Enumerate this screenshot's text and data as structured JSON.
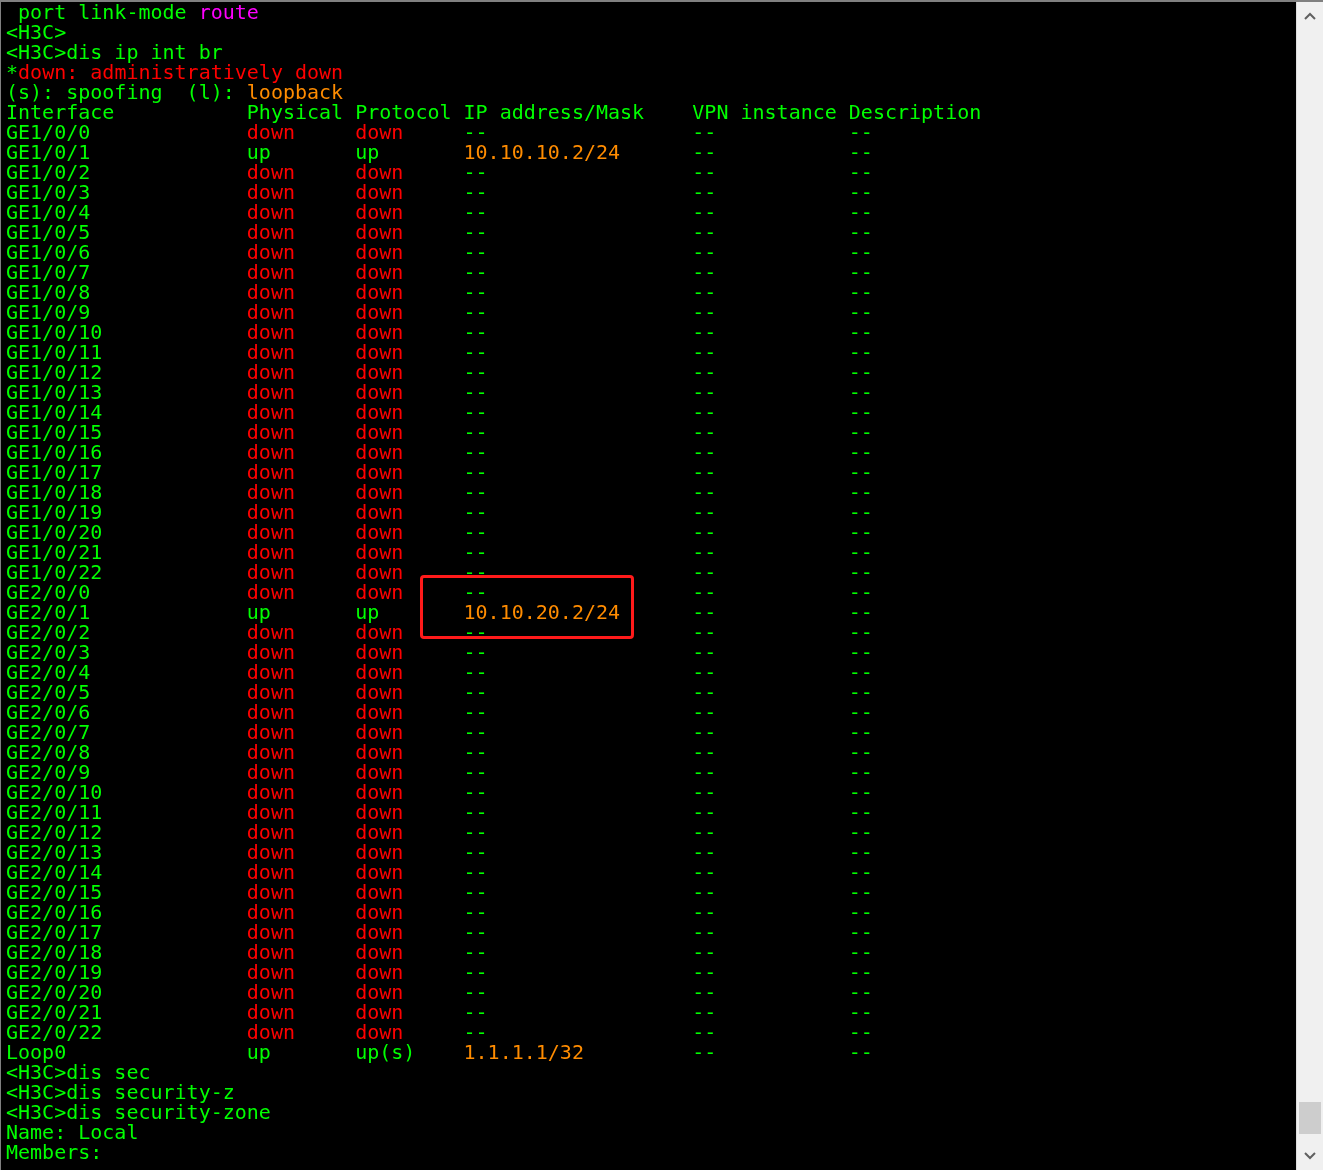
{
  "terminal": {
    "lines_before": [
      {
        "indent": true,
        "segments": [
          {
            "text": "port link-mode ",
            "color": "#00ff00"
          },
          {
            "text": "route",
            "color": "#ff00ff"
          }
        ]
      },
      {
        "indent": false,
        "segments": [
          {
            "text": "<H3C>",
            "color": "#00ff00"
          }
        ]
      },
      {
        "indent": false,
        "segments": [
          {
            "text": "<H3C>dis ip int br",
            "color": "#00ff00"
          }
        ]
      },
      {
        "indent": false,
        "segments": [
          {
            "text": "*",
            "color": "#00ff00"
          },
          {
            "text": "down: administratively down",
            "color": "#ff0000"
          }
        ]
      },
      {
        "indent": false,
        "segments": [
          {
            "text": "(s): spoofing  (l): ",
            "color": "#00ff00"
          },
          {
            "text": "loopback",
            "color": "#ff8c00"
          }
        ]
      }
    ],
    "table": {
      "columns": [
        "Interface",
        "Physical",
        "Protocol",
        "IP address/Mask",
        "VPN instance",
        "Description"
      ],
      "rows": [
        {
          "interface": "GE1/0/0",
          "physical": "down",
          "physical_up": false,
          "protocol": "down",
          "protocol_up": false,
          "ip": "--",
          "ip_assigned": false,
          "vpn": "--",
          "description": "--",
          "highlighted": false
        },
        {
          "interface": "GE1/0/1",
          "physical": "up",
          "physical_up": true,
          "protocol": "up",
          "protocol_up": true,
          "ip": "10.10.10.2/24",
          "ip_assigned": true,
          "vpn": "--",
          "description": "--",
          "highlighted": false
        },
        {
          "interface": "GE1/0/2",
          "physical": "down",
          "physical_up": false,
          "protocol": "down",
          "protocol_up": false,
          "ip": "--",
          "ip_assigned": false,
          "vpn": "--",
          "description": "--",
          "highlighted": false
        },
        {
          "interface": "GE1/0/3",
          "physical": "down",
          "physical_up": false,
          "protocol": "down",
          "protocol_up": false,
          "ip": "--",
          "ip_assigned": false,
          "vpn": "--",
          "description": "--",
          "highlighted": false
        },
        {
          "interface": "GE1/0/4",
          "physical": "down",
          "physical_up": false,
          "protocol": "down",
          "protocol_up": false,
          "ip": "--",
          "ip_assigned": false,
          "vpn": "--",
          "description": "--",
          "highlighted": false
        },
        {
          "interface": "GE1/0/5",
          "physical": "down",
          "physical_up": false,
          "protocol": "down",
          "protocol_up": false,
          "ip": "--",
          "ip_assigned": false,
          "vpn": "--",
          "description": "--",
          "highlighted": false
        },
        {
          "interface": "GE1/0/6",
          "physical": "down",
          "physical_up": false,
          "protocol": "down",
          "protocol_up": false,
          "ip": "--",
          "ip_assigned": false,
          "vpn": "--",
          "description": "--",
          "highlighted": false
        },
        {
          "interface": "GE1/0/7",
          "physical": "down",
          "physical_up": false,
          "protocol": "down",
          "protocol_up": false,
          "ip": "--",
          "ip_assigned": false,
          "vpn": "--",
          "description": "--",
          "highlighted": false
        },
        {
          "interface": "GE1/0/8",
          "physical": "down",
          "physical_up": false,
          "protocol": "down",
          "protocol_up": false,
          "ip": "--",
          "ip_assigned": false,
          "vpn": "--",
          "description": "--",
          "highlighted": false
        },
        {
          "interface": "GE1/0/9",
          "physical": "down",
          "physical_up": false,
          "protocol": "down",
          "protocol_up": false,
          "ip": "--",
          "ip_assigned": false,
          "vpn": "--",
          "description": "--",
          "highlighted": false
        },
        {
          "interface": "GE1/0/10",
          "physical": "down",
          "physical_up": false,
          "protocol": "down",
          "protocol_up": false,
          "ip": "--",
          "ip_assigned": false,
          "vpn": "--",
          "description": "--",
          "highlighted": false
        },
        {
          "interface": "GE1/0/11",
          "physical": "down",
          "physical_up": false,
          "protocol": "down",
          "protocol_up": false,
          "ip": "--",
          "ip_assigned": false,
          "vpn": "--",
          "description": "--",
          "highlighted": false
        },
        {
          "interface": "GE1/0/12",
          "physical": "down",
          "physical_up": false,
          "protocol": "down",
          "protocol_up": false,
          "ip": "--",
          "ip_assigned": false,
          "vpn": "--",
          "description": "--",
          "highlighted": false
        },
        {
          "interface": "GE1/0/13",
          "physical": "down",
          "physical_up": false,
          "protocol": "down",
          "protocol_up": false,
          "ip": "--",
          "ip_assigned": false,
          "vpn": "--",
          "description": "--",
          "highlighted": false
        },
        {
          "interface": "GE1/0/14",
          "physical": "down",
          "physical_up": false,
          "protocol": "down",
          "protocol_up": false,
          "ip": "--",
          "ip_assigned": false,
          "vpn": "--",
          "description": "--",
          "highlighted": false
        },
        {
          "interface": "GE1/0/15",
          "physical": "down",
          "physical_up": false,
          "protocol": "down",
          "protocol_up": false,
          "ip": "--",
          "ip_assigned": false,
          "vpn": "--",
          "description": "--",
          "highlighted": false
        },
        {
          "interface": "GE1/0/16",
          "physical": "down",
          "physical_up": false,
          "protocol": "down",
          "protocol_up": false,
          "ip": "--",
          "ip_assigned": false,
          "vpn": "--",
          "description": "--",
          "highlighted": false
        },
        {
          "interface": "GE1/0/17",
          "physical": "down",
          "physical_up": false,
          "protocol": "down",
          "protocol_up": false,
          "ip": "--",
          "ip_assigned": false,
          "vpn": "--",
          "description": "--",
          "highlighted": false
        },
        {
          "interface": "GE1/0/18",
          "physical": "down",
          "physical_up": false,
          "protocol": "down",
          "protocol_up": false,
          "ip": "--",
          "ip_assigned": false,
          "vpn": "--",
          "description": "--",
          "highlighted": false
        },
        {
          "interface": "GE1/0/19",
          "physical": "down",
          "physical_up": false,
          "protocol": "down",
          "protocol_up": false,
          "ip": "--",
          "ip_assigned": false,
          "vpn": "--",
          "description": "--",
          "highlighted": false
        },
        {
          "interface": "GE1/0/20",
          "physical": "down",
          "physical_up": false,
          "protocol": "down",
          "protocol_up": false,
          "ip": "--",
          "ip_assigned": false,
          "vpn": "--",
          "description": "--",
          "highlighted": false
        },
        {
          "interface": "GE1/0/21",
          "physical": "down",
          "physical_up": false,
          "protocol": "down",
          "protocol_up": false,
          "ip": "--",
          "ip_assigned": false,
          "vpn": "--",
          "description": "--",
          "highlighted": false
        },
        {
          "interface": "GE1/0/22",
          "physical": "down",
          "physical_up": false,
          "protocol": "down",
          "protocol_up": false,
          "ip": "--",
          "ip_assigned": false,
          "vpn": "--",
          "description": "--",
          "highlighted": false
        },
        {
          "interface": "GE2/0/0",
          "physical": "down",
          "physical_up": false,
          "protocol": "down",
          "protocol_up": false,
          "ip": "--",
          "ip_assigned": false,
          "vpn": "--",
          "description": "--",
          "highlighted": false
        },
        {
          "interface": "GE2/0/1",
          "physical": "up",
          "physical_up": true,
          "protocol": "up",
          "protocol_up": true,
          "ip": "10.10.20.2/24",
          "ip_assigned": true,
          "vpn": "--",
          "description": "--",
          "highlighted": true
        },
        {
          "interface": "GE2/0/2",
          "physical": "down",
          "physical_up": false,
          "protocol": "down",
          "protocol_up": false,
          "ip": "--",
          "ip_assigned": false,
          "vpn": "--",
          "description": "--",
          "highlighted": false
        },
        {
          "interface": "GE2/0/3",
          "physical": "down",
          "physical_up": false,
          "protocol": "down",
          "protocol_up": false,
          "ip": "--",
          "ip_assigned": false,
          "vpn": "--",
          "description": "--",
          "highlighted": false
        },
        {
          "interface": "GE2/0/4",
          "physical": "down",
          "physical_up": false,
          "protocol": "down",
          "protocol_up": false,
          "ip": "--",
          "ip_assigned": false,
          "vpn": "--",
          "description": "--",
          "highlighted": false
        },
        {
          "interface": "GE2/0/5",
          "physical": "down",
          "physical_up": false,
          "protocol": "down",
          "protocol_up": false,
          "ip": "--",
          "ip_assigned": false,
          "vpn": "--",
          "description": "--",
          "highlighted": false
        },
        {
          "interface": "GE2/0/6",
          "physical": "down",
          "physical_up": false,
          "protocol": "down",
          "protocol_up": false,
          "ip": "--",
          "ip_assigned": false,
          "vpn": "--",
          "description": "--",
          "highlighted": false
        },
        {
          "interface": "GE2/0/7",
          "physical": "down",
          "physical_up": false,
          "protocol": "down",
          "protocol_up": false,
          "ip": "--",
          "ip_assigned": false,
          "vpn": "--",
          "description": "--",
          "highlighted": false
        },
        {
          "interface": "GE2/0/8",
          "physical": "down",
          "physical_up": false,
          "protocol": "down",
          "protocol_up": false,
          "ip": "--",
          "ip_assigned": false,
          "vpn": "--",
          "description": "--",
          "highlighted": false
        },
        {
          "interface": "GE2/0/9",
          "physical": "down",
          "physical_up": false,
          "protocol": "down",
          "protocol_up": false,
          "ip": "--",
          "ip_assigned": false,
          "vpn": "--",
          "description": "--",
          "highlighted": false
        },
        {
          "interface": "GE2/0/10",
          "physical": "down",
          "physical_up": false,
          "protocol": "down",
          "protocol_up": false,
          "ip": "--",
          "ip_assigned": false,
          "vpn": "--",
          "description": "--",
          "highlighted": false
        },
        {
          "interface": "GE2/0/11",
          "physical": "down",
          "physical_up": false,
          "protocol": "down",
          "protocol_up": false,
          "ip": "--",
          "ip_assigned": false,
          "vpn": "--",
          "description": "--",
          "highlighted": false
        },
        {
          "interface": "GE2/0/12",
          "physical": "down",
          "physical_up": false,
          "protocol": "down",
          "protocol_up": false,
          "ip": "--",
          "ip_assigned": false,
          "vpn": "--",
          "description": "--",
          "highlighted": false
        },
        {
          "interface": "GE2/0/13",
          "physical": "down",
          "physical_up": false,
          "protocol": "down",
          "protocol_up": false,
          "ip": "--",
          "ip_assigned": false,
          "vpn": "--",
          "description": "--",
          "highlighted": false
        },
        {
          "interface": "GE2/0/14",
          "physical": "down",
          "physical_up": false,
          "protocol": "down",
          "protocol_up": false,
          "ip": "--",
          "ip_assigned": false,
          "vpn": "--",
          "description": "--",
          "highlighted": false
        },
        {
          "interface": "GE2/0/15",
          "physical": "down",
          "physical_up": false,
          "protocol": "down",
          "protocol_up": false,
          "ip": "--",
          "ip_assigned": false,
          "vpn": "--",
          "description": "--",
          "highlighted": false
        },
        {
          "interface": "GE2/0/16",
          "physical": "down",
          "physical_up": false,
          "protocol": "down",
          "protocol_up": false,
          "ip": "--",
          "ip_assigned": false,
          "vpn": "--",
          "description": "--",
          "highlighted": false
        },
        {
          "interface": "GE2/0/17",
          "physical": "down",
          "physical_up": false,
          "protocol": "down",
          "protocol_up": false,
          "ip": "--",
          "ip_assigned": false,
          "vpn": "--",
          "description": "--",
          "highlighted": false
        },
        {
          "interface": "GE2/0/18",
          "physical": "down",
          "physical_up": false,
          "protocol": "down",
          "protocol_up": false,
          "ip": "--",
          "ip_assigned": false,
          "vpn": "--",
          "description": "--",
          "highlighted": false
        },
        {
          "interface": "GE2/0/19",
          "physical": "down",
          "physical_up": false,
          "protocol": "down",
          "protocol_up": false,
          "ip": "--",
          "ip_assigned": false,
          "vpn": "--",
          "description": "--",
          "highlighted": false
        },
        {
          "interface": "GE2/0/20",
          "physical": "down",
          "physical_up": false,
          "protocol": "down",
          "protocol_up": false,
          "ip": "--",
          "ip_assigned": false,
          "vpn": "--",
          "description": "--",
          "highlighted": false
        },
        {
          "interface": "GE2/0/21",
          "physical": "down",
          "physical_up": false,
          "protocol": "down",
          "protocol_up": false,
          "ip": "--",
          "ip_assigned": false,
          "vpn": "--",
          "description": "--",
          "highlighted": false
        },
        {
          "interface": "GE2/0/22",
          "physical": "down",
          "physical_up": false,
          "protocol": "down",
          "protocol_up": false,
          "ip": "--",
          "ip_assigned": false,
          "vpn": "--",
          "description": "--",
          "highlighted": false
        },
        {
          "interface": "Loop0",
          "physical": "up",
          "physical_up": true,
          "protocol": "up(s)",
          "protocol_up": true,
          "ip": "1.1.1.1/32",
          "ip_assigned": true,
          "vpn": "--",
          "description": "--",
          "highlighted": false
        }
      ]
    },
    "lines_after": [
      "<H3C>dis sec",
      "<H3C>dis security-z",
      "<H3C>dis security-zone",
      "Name: Local",
      "Members:"
    ]
  }
}
